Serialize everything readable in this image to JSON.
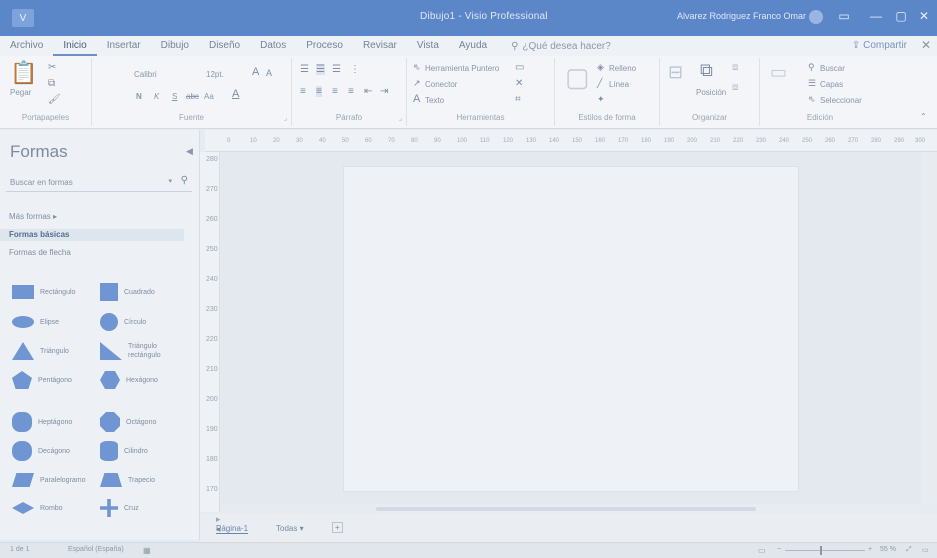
{
  "titlebar": {
    "app_icon": "visio-icon",
    "document_title": "Dibujo1  -  Visio Professional",
    "user": "Alvarez Rodriguez Franco Omar",
    "buttons": {
      "ribbon_options": "▭",
      "minimize": "—",
      "maximize": "▢",
      "close": "✕"
    }
  },
  "ribbon_tabs": [
    "Archivo",
    "Inicio",
    "Insertar",
    "Dibujo",
    "Diseño",
    "Datos",
    "Proceso",
    "Revisar",
    "Vista",
    "Ayuda"
  ],
  "active_tab": "Inicio",
  "tell_me": "¿Qué desea hacer?",
  "share_label": "Compartir",
  "ribbon": {
    "clipboard": {
      "label": "Portapapeles",
      "paste": "Pegar"
    },
    "font": {
      "label": "Fuente",
      "family": "Calibri",
      "size": "12pt.",
      "grow": "A",
      "shrink": "A",
      "bold": "N",
      "italic": "K",
      "underline": "S",
      "strike": "abc",
      "case": "Aa",
      "color": "A"
    },
    "paragraph": {
      "label": "Párrafo"
    },
    "tools": {
      "label": "Herramientas",
      "pointer": "Herramienta Puntero",
      "connector": "Conector",
      "text": "Texto"
    },
    "shape_styles": {
      "label": "Estilos de forma",
      "fill": "Relleno",
      "line": "Línea",
      "effects": "Efectos"
    },
    "arrange": {
      "label": "Organizar",
      "position": "Posición"
    },
    "editing": {
      "label": "Edición",
      "find": "Buscar",
      "layers": "Capas",
      "select": "Seleccionar"
    }
  },
  "shapes_pane": {
    "title": "Formas",
    "search_placeholder": "Buscar en formas",
    "more_shapes": "Más formas",
    "stencils": [
      "Formas básicas",
      "Formas de flecha"
    ],
    "selected_stencil": "Formas básicas",
    "items": [
      {
        "label": "Rectángulo",
        "icon": "rectangle-shape"
      },
      {
        "label": "Cuadrado",
        "icon": "square-shape"
      },
      {
        "label": "Elipse",
        "icon": "ellipse-shape"
      },
      {
        "label": "Círculo",
        "icon": "circle-shape"
      },
      {
        "label": "Triángulo",
        "icon": "triangle-shape"
      },
      {
        "label": "Triángulo rectángulo",
        "icon": "right-triangle-shape"
      },
      {
        "label": "Pentágono",
        "icon": "pentagon-shape"
      },
      {
        "label": "Hexágono",
        "icon": "hexagon-shape"
      },
      {
        "label": "Heptágono",
        "icon": "heptagon-shape"
      },
      {
        "label": "Octágono",
        "icon": "octagon-shape"
      },
      {
        "label": "Decágono",
        "icon": "decagon-shape"
      },
      {
        "label": "Cilindro",
        "icon": "cylinder-shape"
      },
      {
        "label": "Paralelogramo",
        "icon": "parallelogram-shape"
      },
      {
        "label": "Trapecio",
        "icon": "trapezoid-shape"
      },
      {
        "label": "Rombo",
        "icon": "diamond-shape"
      },
      {
        "label": "Cruz",
        "icon": "cross-shape"
      }
    ]
  },
  "ruler_top": [
    "0",
    "10",
    "20",
    "30",
    "40",
    "50",
    "60",
    "70",
    "80",
    "90",
    "100",
    "110",
    "120",
    "130",
    "140",
    "150",
    "160",
    "170",
    "180",
    "190",
    "200",
    "210",
    "220",
    "230",
    "240",
    "250",
    "260",
    "270",
    "280",
    "290",
    "300"
  ],
  "ruler_left": [
    "280",
    "270",
    "260",
    "250",
    "240",
    "230",
    "220",
    "210",
    "200",
    "190",
    "180",
    "170"
  ],
  "page_tabs": {
    "page": "Página-1",
    "all": "Todas",
    "add": "+"
  },
  "status": {
    "page": "1 de 1",
    "language": "Español (España)",
    "zoom": "55 %",
    "fit": "⤢",
    "switch": "▭"
  }
}
